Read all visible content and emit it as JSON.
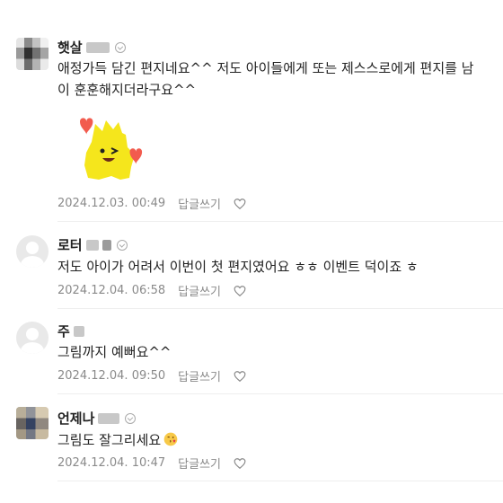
{
  "comments": [
    {
      "name": "햇살",
      "text_lines": [
        "애정가득 담긴 편지네요^^ 저도 아이들에게 또는 제스스로에게 편지를 남",
        "이 훈훈해지더라구요^^"
      ],
      "date": "2024.12.03. 00:49",
      "reply_label": "답글쓰기",
      "has_sticker": true
    },
    {
      "name": "로터",
      "text_lines": [
        "저도 아이가 어려서 이번이 첫 편지였어요 ㅎㅎ 이벤트 덕이죠 ㅎ"
      ],
      "date": "2024.12.04. 06:58",
      "reply_label": "답글쓰기"
    },
    {
      "name": "주",
      "text_lines": [
        "그림까지 예뻐요^^"
      ],
      "date": "2024.12.04. 09:50",
      "reply_label": "답글쓰기"
    },
    {
      "name": "언제나",
      "text_lines": [
        "그림도 잘그리세요"
      ],
      "date": "2024.12.04. 10:47",
      "reply_label": "답글쓰기",
      "emoji": "face-blowing-kiss-emoji"
    }
  ],
  "icons": {
    "like": "heart-outline-icon",
    "badge": "badge-check-icon",
    "avatar_default": "default-user-avatar-icon"
  },
  "colors": {
    "meta_text": "#8a8a8a",
    "sticker_yellow": "#f5e61c",
    "sticker_heart": "#f25b4e"
  }
}
